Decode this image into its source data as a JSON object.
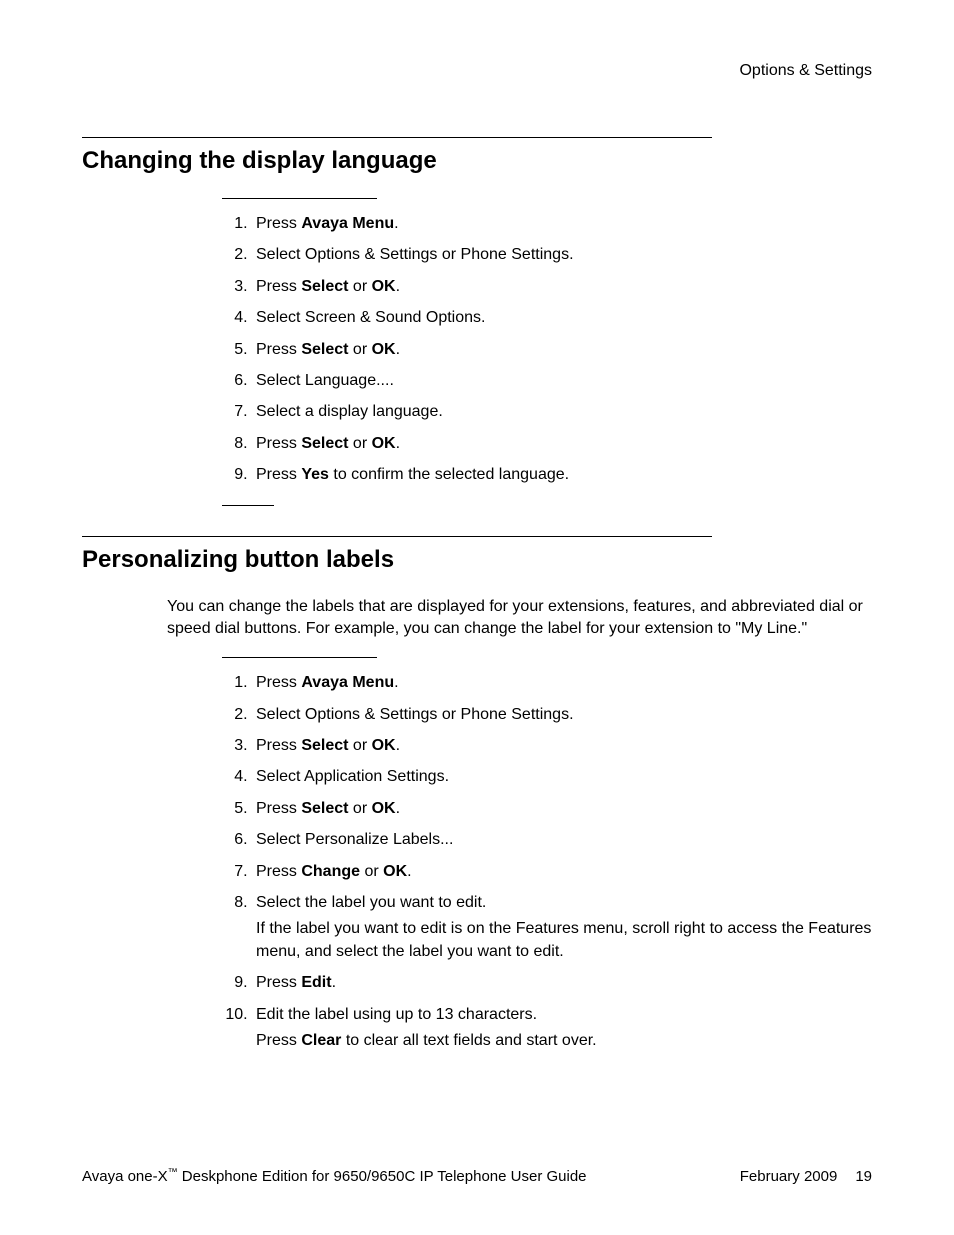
{
  "header": {
    "category": "Options & Settings"
  },
  "section1": {
    "heading": "Changing the display language",
    "steps": [
      {
        "html": "Press <b>Avaya Menu</b>."
      },
      {
        "html": "Select Options & Settings or Phone Settings."
      },
      {
        "html": "Press <b>Select</b> or <b>OK</b>."
      },
      {
        "html": "Select Screen & Sound Options."
      },
      {
        "html": "Press <b>Select</b> or <b>OK</b>."
      },
      {
        "html": "Select Language...."
      },
      {
        "html": "Select a display language."
      },
      {
        "html": "Press <b>Select</b> or <b>OK</b>."
      },
      {
        "html": "Press <b>Yes</b> to confirm the selected language."
      }
    ]
  },
  "section2": {
    "heading": "Personalizing button labels",
    "intro": "You can change the labels that are displayed for your extensions, features, and abbreviated dial or speed dial buttons. For example, you can change the label for your extension to \"My Line.\"",
    "steps": [
      {
        "html": "Press <b>Avaya Menu</b>."
      },
      {
        "html": "Select Options & Settings or Phone Settings."
      },
      {
        "html": "Press <b>Select</b> or <b>OK</b>."
      },
      {
        "html": "Select Application Settings."
      },
      {
        "html": "Press <b>Select</b> or <b>OK</b>."
      },
      {
        "html": "Select Personalize Labels..."
      },
      {
        "html": "Press <b>Change</b> or <b>OK</b>."
      },
      {
        "html": "Select the label you want to edit.",
        "sub": "If the label you want to edit is on the Features menu, scroll right to access the Features menu, and select the label you want to edit."
      },
      {
        "html": "Press <b>Edit</b>."
      },
      {
        "html": "Edit the label using up to 13 characters.",
        "sub": "Press <b>Clear</b> to clear all text fields and start over."
      }
    ]
  },
  "footer": {
    "left_prefix": "Avaya one-X",
    "left_tm": "™",
    "left_suffix": " Deskphone Edition for 9650/9650C IP Telephone User Guide",
    "date": "February 2009",
    "page": "19"
  }
}
